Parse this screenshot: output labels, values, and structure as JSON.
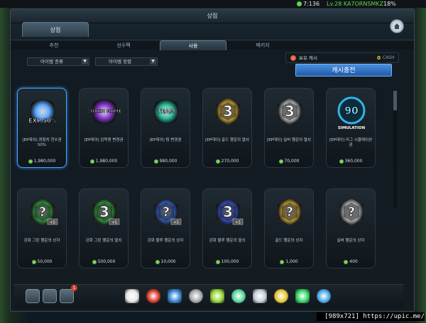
{
  "status_bar": {
    "time": "7:136",
    "user": "Lv.28 KA7ORNSMKZ",
    "battery": "18%"
  },
  "window": {
    "title": "상점",
    "close_icon": "home-icon"
  },
  "top_tab": "상점",
  "sub_tabs": [
    "추천",
    "선수팩",
    "사용",
    "패키지"
  ],
  "active_sub_tab": "사용",
  "filters": {
    "item_type": "아이템 종류",
    "item_sort": "아이템 정렬"
  },
  "cash": {
    "label": "보유 캐시",
    "value": "0",
    "unit": "CASH",
    "charge_button": "캐시충전"
  },
  "items_row1": [
    {
      "name": "[EP데이] 경험치 전수권 50%",
      "price": "1,980,000",
      "art_text": "EXP 50%",
      "color": "#5aa6ff",
      "selected": true
    },
    {
      "name": "[EP데이] 감독명 변경권",
      "price": "1,980,000",
      "art_text": "COACH NAME",
      "color": "#8a3ad8"
    },
    {
      "name": "[EP데이] 팀 변경권",
      "price": "980,000",
      "art_text": "TEAM",
      "color": "#2ac0a0"
    },
    {
      "name": "[EP데이] 골드 행운의 열쇠",
      "price": "270,000",
      "art_text": "3",
      "color": "#d8b040"
    },
    {
      "name": "[EP데이] 실버 행운의 열쇠",
      "price": "70,000",
      "art_text": "3",
      "color": "#c8ccd0"
    },
    {
      "name": "[EP데이] 리그 시뮬레이션권",
      "price": "360,000",
      "art_text": "90",
      "color": "#2ab8e8",
      "subtext": "SIMULATION"
    }
  ],
  "items_row2": [
    {
      "name": "강화 그린 행운의 상자",
      "price": "50,000",
      "art_text": "?",
      "color": "#3aa84a",
      "tag": "+5"
    },
    {
      "name": "강화 그린 행운의 열쇠",
      "price": "500,000",
      "art_text": "3",
      "color": "#3aa84a",
      "tag": "+5"
    },
    {
      "name": "강화 블루 행운의 상자",
      "price": "10,000",
      "art_text": "?",
      "color": "#3a6ad8",
      "tag": "+5"
    },
    {
      "name": "강화 블루 행운의 열쇠",
      "price": "100,000",
      "art_text": "3",
      "color": "#3a5ad8",
      "tag": "+5"
    },
    {
      "name": "골드 행운의 상자",
      "price": "1,000",
      "art_text": "?",
      "color": "#d8b040"
    },
    {
      "name": "실버 행운의 상자",
      "price": "400",
      "art_text": "?",
      "color": "#c8ccd0"
    }
  ],
  "dock": {
    "left_icons": [
      "card-icon",
      "calendar-icon",
      "shop-icon"
    ],
    "badge": "1",
    "right_icons": [
      "whistle-icon",
      "ball-icon",
      "boots-icon",
      "trophy-icon",
      "cone-icon",
      "board-icon",
      "ticket-icon",
      "badge-icon",
      "stats-icon",
      "basket-icon"
    ]
  },
  "watermark": "[989x721] https://upic.me/"
}
